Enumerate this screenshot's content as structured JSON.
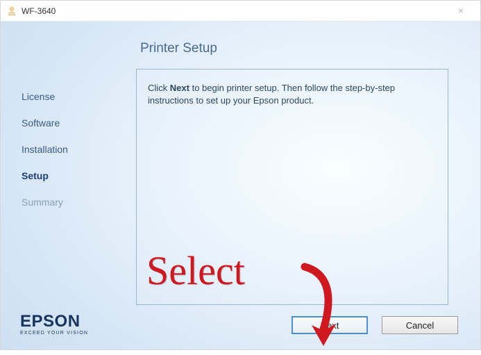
{
  "window": {
    "title": "WF-3640",
    "close_glyph": "×"
  },
  "sidebar": {
    "items": [
      {
        "label": "License",
        "state": "done"
      },
      {
        "label": "Software",
        "state": "done"
      },
      {
        "label": "Installation",
        "state": "done"
      },
      {
        "label": "Setup",
        "state": "current"
      },
      {
        "label": "Summary",
        "state": "future"
      }
    ]
  },
  "main": {
    "page_title": "Printer Setup",
    "instruction_pre": "Click ",
    "instruction_bold": "Next",
    "instruction_post": " to begin printer setup. Then follow the step-by-step instructions to set up your Epson product."
  },
  "brand": {
    "name": "EPSON",
    "tagline": "EXCEED YOUR VISION"
  },
  "buttons": {
    "next": "Next",
    "cancel": "Cancel"
  },
  "annotation": {
    "text": "Select",
    "color": "#cf1820"
  }
}
